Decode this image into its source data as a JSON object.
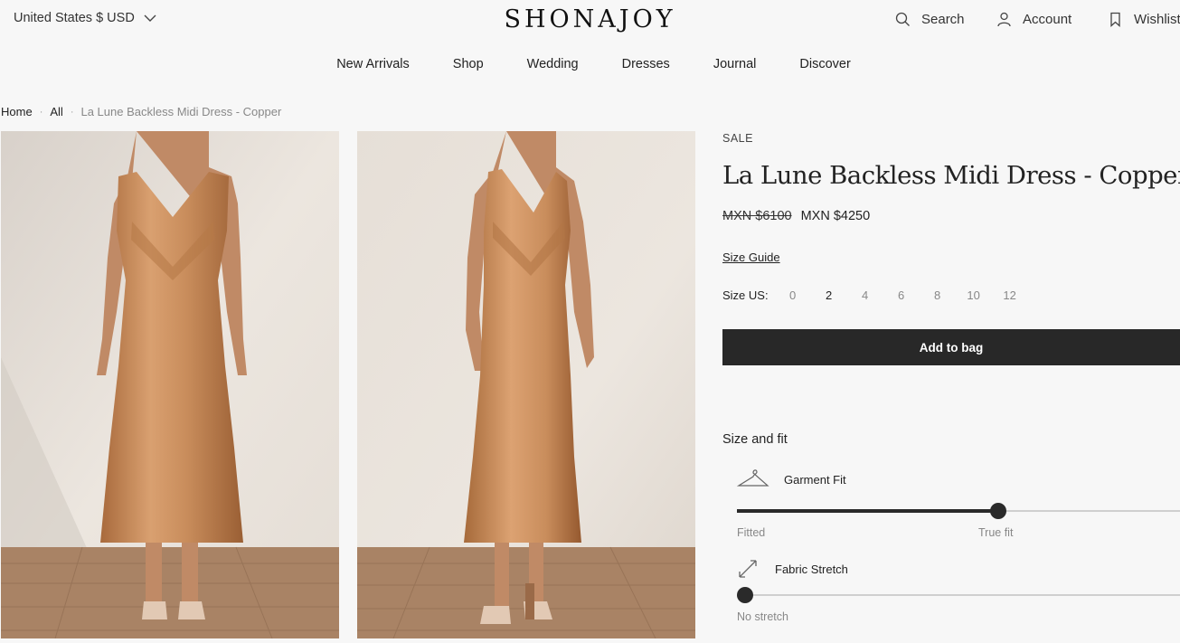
{
  "header": {
    "currency": "United States $ USD",
    "logo": "SHONAJOY",
    "search_label": "Search",
    "account_label": "Account",
    "wishlist_label": "Wishlist"
  },
  "nav": [
    "New Arrivals",
    "Shop",
    "Wedding",
    "Dresses",
    "Journal",
    "Discover"
  ],
  "breadcrumb": {
    "home": "Home",
    "all": "All",
    "current": "La Lune Backless Midi Dress - Copper"
  },
  "product": {
    "badge": "SALE",
    "title": "La Lune Backless Midi Dress - Copper",
    "price_old": "MXN $6100",
    "price_new": "MXN $4250",
    "size_guide": "Size Guide",
    "size_label": "Size US:",
    "sizes": [
      "0",
      "2",
      "4",
      "6",
      "8",
      "10",
      "12"
    ],
    "selected_size": "2",
    "add_to_bag": "Add to bag"
  },
  "fit": {
    "title": "Size and fit",
    "garment_fit_label": "Garment Fit",
    "garment_fit_value": "True fit",
    "garment_fit_min": "Fitted",
    "garment_fit_level": 0.59,
    "fabric_stretch_label": "Fabric Stretch",
    "fabric_stretch_min": "No stretch",
    "fabric_stretch_level": 0
  },
  "colors": {
    "dress": "#c98d5c",
    "wall": "#ece6df",
    "floor": "#a98365",
    "button": "#282828"
  }
}
